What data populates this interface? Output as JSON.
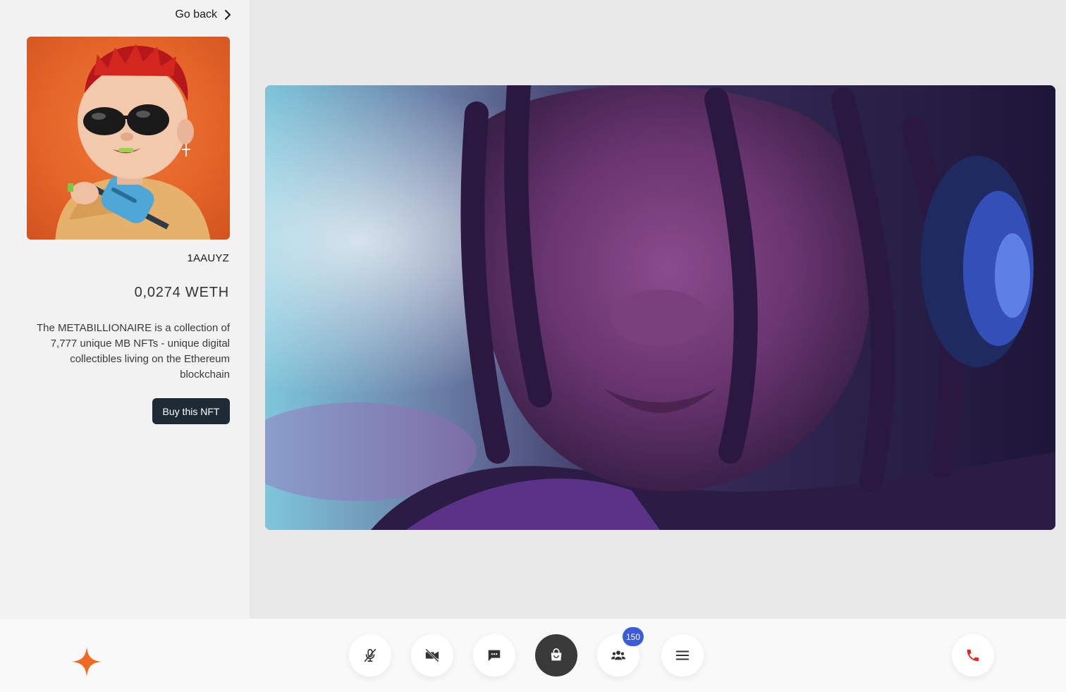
{
  "sidebar": {
    "go_back_label": "Go back",
    "nft": {
      "id": "1AAUYZ",
      "price": "0,0274 WETH",
      "description": "The METABILLIONAIRE is a collection of 7,777 unique MB NFTs - unique digital collectibles living on the Ethereum blockchain",
      "buy_label": "Buy this NFT"
    }
  },
  "controls": [
    {
      "name": "mute-mic",
      "icon": "mic-off-icon"
    },
    {
      "name": "camera-off",
      "icon": "video-off-icon"
    },
    {
      "name": "chat",
      "icon": "chat-icon"
    },
    {
      "name": "shop",
      "icon": "shopping-bag-icon",
      "active": true
    },
    {
      "name": "participants",
      "icon": "people-icon",
      "badge": "150"
    },
    {
      "name": "menu",
      "icon": "menu-icon"
    },
    {
      "name": "end-call",
      "icon": "phone-icon"
    }
  ],
  "colors": {
    "accent_orange": "#ee6a25",
    "dark_button": "#1e2a35",
    "badge_blue": "#3b5bd9",
    "end_call_red": "#e8251f"
  }
}
